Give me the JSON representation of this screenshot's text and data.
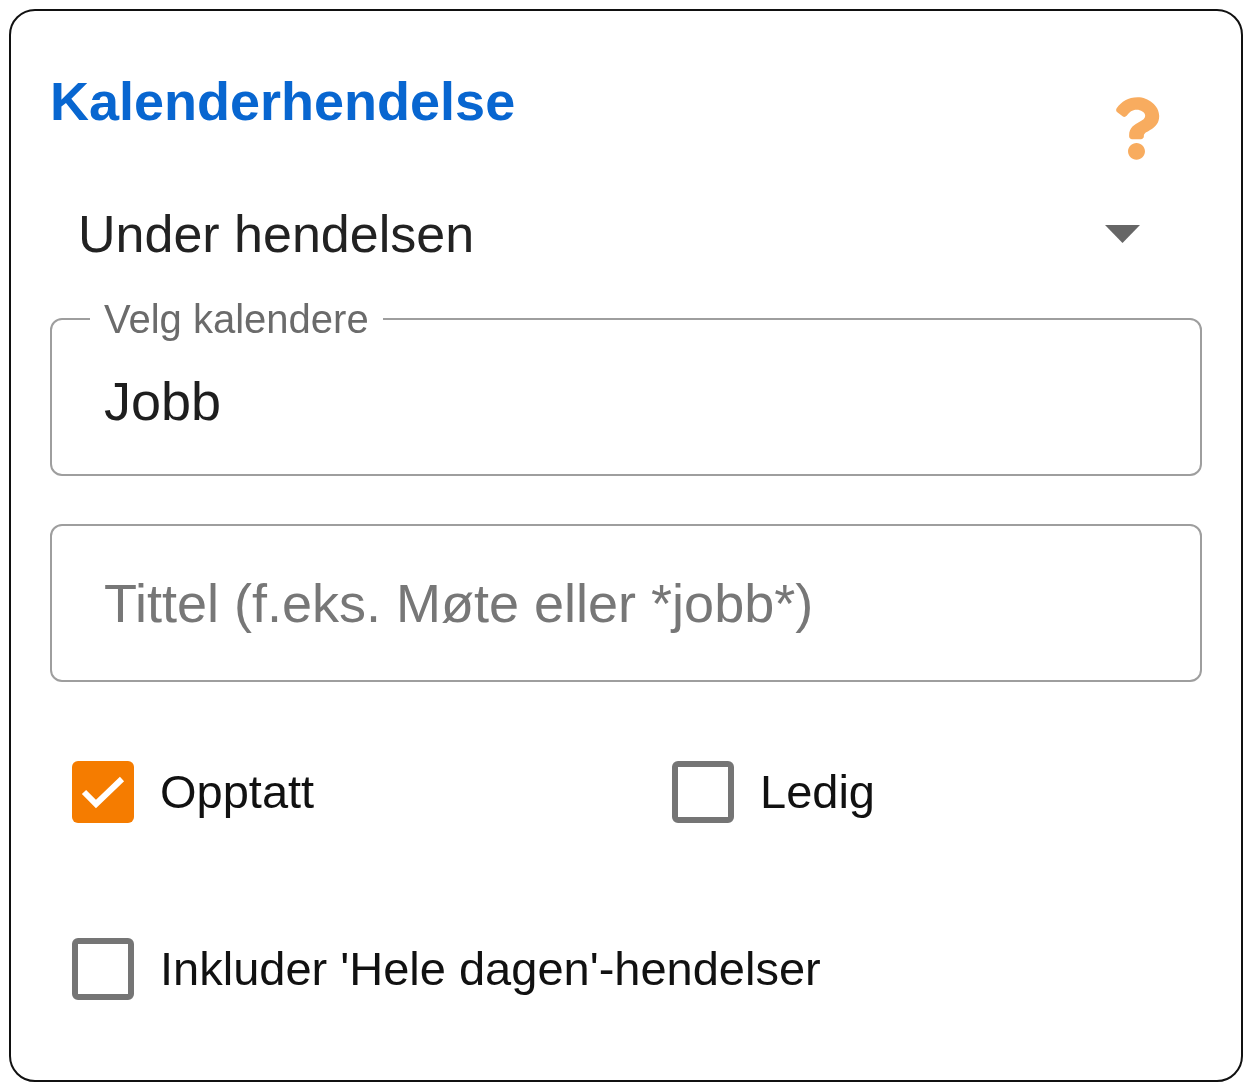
{
  "title": "Kalenderhendelse",
  "dropdown": {
    "value": "Under hendelsen"
  },
  "calendar_field": {
    "label": "Velg kalendere",
    "value": "Jobb"
  },
  "title_field": {
    "placeholder": "Tittel (f.eks. Møte eller *jobb*)"
  },
  "status_options": [
    {
      "label": "Opptatt",
      "checked": true
    },
    {
      "label": "Ledig",
      "checked": false
    }
  ],
  "all_day_option": {
    "label": "Inkluder 'Hele dagen'-hendelser",
    "checked": false
  }
}
